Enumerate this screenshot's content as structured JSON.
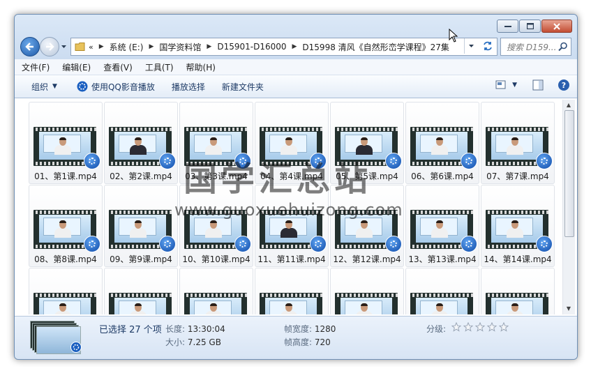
{
  "address": {
    "overflow": "«",
    "crumbs": [
      "系统 (E:)",
      "国学资料馆",
      "D15901-D16000",
      "D15998 清风《自然形峦学课程》27集"
    ]
  },
  "search": {
    "placeholder": "搜索 D159..."
  },
  "menu": [
    "文件(F)",
    "编辑(E)",
    "查看(V)",
    "工具(T)",
    "帮助(H)"
  ],
  "toolbar": {
    "organize": "组织",
    "play_qq": "使用QQ影音播放",
    "play_selection": "播放选择",
    "new_folder": "新建文件夹"
  },
  "files": [
    {
      "name": "01、第1课.mp4"
    },
    {
      "name": "02、第2课.mp4"
    },
    {
      "name": "03、第3课.mp4"
    },
    {
      "name": "04、第4课.mp4"
    },
    {
      "name": "05、第5课.mp4"
    },
    {
      "name": "06、第6课.mp4"
    },
    {
      "name": "07、第7课.mp4"
    },
    {
      "name": "08、第8课.mp4"
    },
    {
      "name": "09、第9课.mp4"
    },
    {
      "name": "10、第10课.mp4"
    },
    {
      "name": "11、第11课.mp4"
    },
    {
      "name": "12、第12课.mp4"
    },
    {
      "name": "13、第13课.mp4"
    },
    {
      "name": "14、第14课.mp4"
    }
  ],
  "details": {
    "selected": "已选择 27 个项",
    "length_label": "长度:",
    "length": "13:30:04",
    "size_label": "大小:",
    "size": "7.25 GB",
    "width_label": "帧宽度:",
    "width": "1280",
    "height_label": "帧高度:",
    "height": "720",
    "rating_label": "分级:",
    "rating_stars": 0
  },
  "watermark": {
    "title": "国学汇总站",
    "url": "www.guoxuehuizong.com"
  },
  "colors": {
    "accent": "#1f5aa8",
    "close": "#c34d33"
  }
}
